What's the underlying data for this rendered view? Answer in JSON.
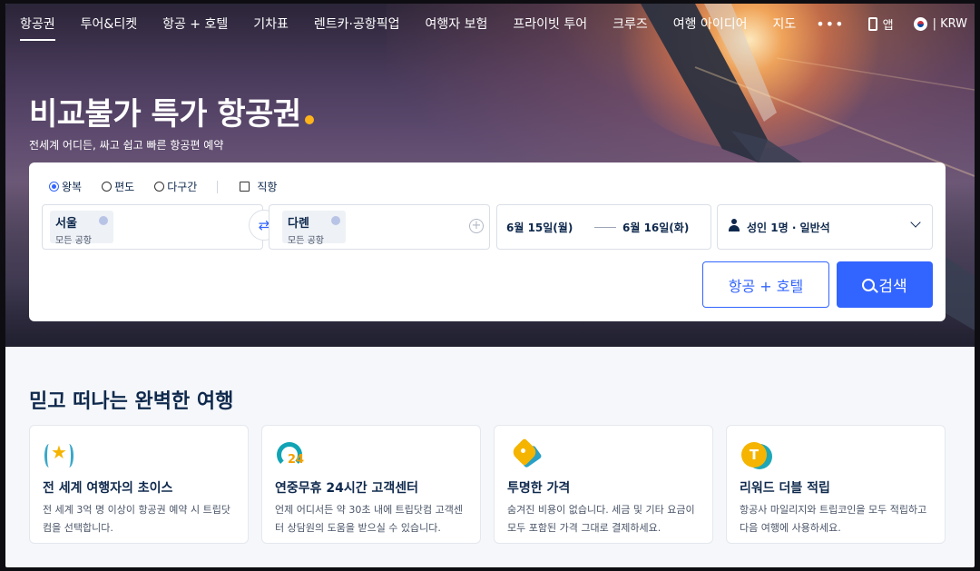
{
  "nav": {
    "items": [
      {
        "label": "항공권",
        "active": true
      },
      {
        "label": "투어&티켓"
      },
      {
        "label": "항공 + 호텔"
      },
      {
        "label": "기차표"
      },
      {
        "label": "렌트카·공항픽업"
      },
      {
        "label": "여행자 보험"
      },
      {
        "label": "프라이빗 투어"
      },
      {
        "label": "크루즈"
      },
      {
        "label": "여행 아이디어"
      },
      {
        "label": "지도"
      }
    ],
    "more_label": "•••",
    "app_label": "앱",
    "currency_label": "| KRW"
  },
  "hero": {
    "headline": "비교불가 특가 항공권",
    "subline": "전세계 어디든, 싸고 쉽고 빠른 항공편 예약"
  },
  "search": {
    "trip_types": [
      "왕복",
      "편도",
      "다구간"
    ],
    "selected_trip_type": "왕복",
    "direct_label": "직항",
    "from": {
      "city": "서울",
      "airport": "모든 공항"
    },
    "to": {
      "city": "다롄",
      "airport": "모든 공항"
    },
    "depart_date": "6월 15일(월)",
    "return_date": "6월 16일(화)",
    "passengers": "성인 1명 · 일반석",
    "bundle_button": "항공 + 호텔",
    "search_button": "검색"
  },
  "features": {
    "title": "믿고 떠나는 완벽한 여행",
    "items": [
      {
        "icon": "laurel-star-icon",
        "title": "전 세계 여행자의 초이스",
        "desc": "전 세계 3억 명 이상이 항공권 예약 시 트립닷컴을 선택합니다."
      },
      {
        "icon": "headset-24-icon",
        "title": "연중무휴 24시간 고객센터",
        "desc": "언제 어디서든 약 30초 내에 트립닷컴 고객센터 상담원의 도움을 받으실 수 있습니다."
      },
      {
        "icon": "price-tag-icon",
        "title": "투명한 가격",
        "desc": "숨겨진 비용이 없습니다. 세금 및 기타 요금이 모두 포함된 가격 그대로 결제하세요."
      },
      {
        "icon": "trip-coin-icon",
        "title": "리워드 더블 적립",
        "desc": "항공사 마일리지와 트립코인을 모두 적립하고 다음 여행에 사용하세요."
      }
    ]
  },
  "colors": {
    "primary": "#3264ff",
    "text": "#0f294d",
    "accent": "#ffb31a"
  }
}
